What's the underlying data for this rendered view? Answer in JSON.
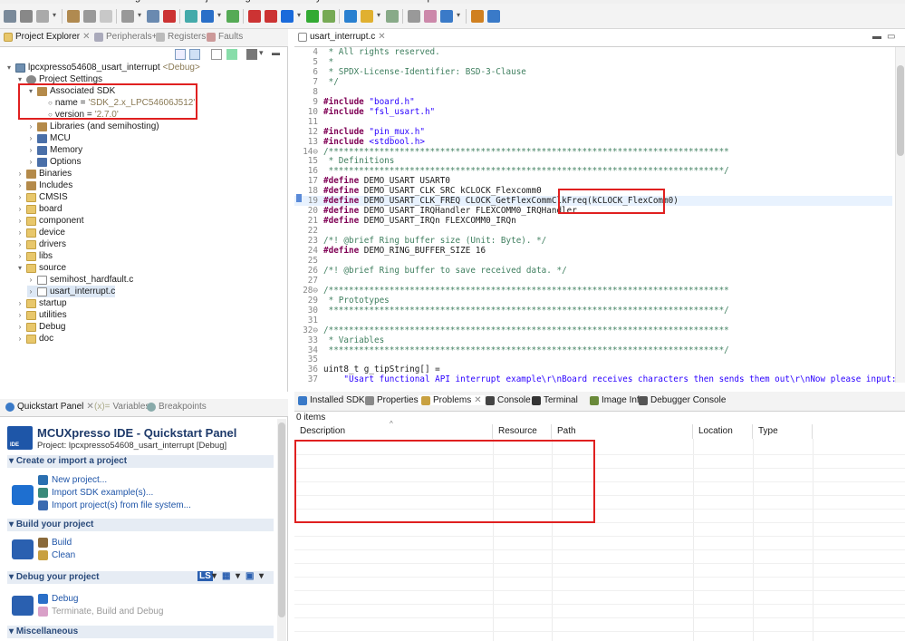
{
  "menubar": {
    "items": [
      "File",
      "Edit",
      "Source",
      "Refactor",
      "Navigate",
      "Search",
      "Project",
      "ConfigTools",
      "Run",
      "Analysis",
      "FreeRTOS",
      "Window",
      "Help"
    ]
  },
  "project_explorer": {
    "tabs": [
      {
        "label": "Project Explorer",
        "active": true,
        "icon": "folder-icon"
      },
      {
        "label": "Peripherals+",
        "active": false,
        "icon": "peripherals-icon"
      },
      {
        "label": "Registers",
        "active": false,
        "icon": "registers-icon"
      },
      {
        "label": "Faults",
        "active": false,
        "icon": "faults-icon"
      }
    ],
    "tree": [
      {
        "label": "lpcxpresso54608_usart_interrupt",
        "suffix": "<Debug>",
        "level": 0,
        "twisty": "expanded",
        "icon": "project-icon"
      },
      {
        "label": "Project Settings",
        "level": 1,
        "twisty": "expanded",
        "icon": "settings-icon"
      },
      {
        "label": "Associated SDK",
        "level": 2,
        "twisty": "expanded",
        "icon": "sdk-icon"
      },
      {
        "label": "name = ",
        "value": "'SDK_2.x_LPC54606J512'",
        "level": 3,
        "twisty": "none",
        "icon": "bullet-icon"
      },
      {
        "label": "version = ",
        "value": "'2.7.0'",
        "level": 3,
        "twisty": "none",
        "icon": "bullet-icon"
      },
      {
        "label": "Libraries (and semihosting)",
        "level": 2,
        "twisty": "collapsed",
        "icon": "library-icon"
      },
      {
        "label": "MCU",
        "level": 2,
        "twisty": "collapsed",
        "icon": "mcu-icon"
      },
      {
        "label": "Memory",
        "level": 2,
        "twisty": "collapsed",
        "icon": "memory-icon"
      },
      {
        "label": "Options",
        "level": 2,
        "twisty": "collapsed",
        "icon": "options-icon"
      },
      {
        "label": "Binaries",
        "level": 1,
        "twisty": "collapsed",
        "icon": "binaries-icon"
      },
      {
        "label": "Includes",
        "level": 1,
        "twisty": "collapsed",
        "icon": "includes-icon"
      },
      {
        "label": "CMSIS",
        "level": 1,
        "twisty": "collapsed",
        "icon": "folder-icon"
      },
      {
        "label": "board",
        "level": 1,
        "twisty": "collapsed",
        "icon": "folder-icon"
      },
      {
        "label": "component",
        "level": 1,
        "twisty": "collapsed",
        "icon": "folder-icon"
      },
      {
        "label": "device",
        "level": 1,
        "twisty": "collapsed",
        "icon": "folder-icon"
      },
      {
        "label": "drivers",
        "level": 1,
        "twisty": "collapsed",
        "icon": "folder-icon"
      },
      {
        "label": "libs",
        "level": 1,
        "twisty": "collapsed",
        "icon": "folder-icon"
      },
      {
        "label": "source",
        "level": 1,
        "twisty": "expanded",
        "icon": "folder-icon"
      },
      {
        "label": "semihost_hardfault.c",
        "level": 2,
        "twisty": "collapsed",
        "icon": "c-file-icon"
      },
      {
        "label": "usart_interrupt.c",
        "level": 2,
        "twisty": "collapsed",
        "icon": "c-file-icon",
        "selected": true
      },
      {
        "label": "startup",
        "level": 1,
        "twisty": "collapsed",
        "icon": "folder-icon"
      },
      {
        "label": "utilities",
        "level": 1,
        "twisty": "collapsed",
        "icon": "folder-icon"
      },
      {
        "label": "Debug",
        "level": 1,
        "twisty": "collapsed",
        "icon": "folder-icon"
      },
      {
        "label": "doc",
        "level": 1,
        "twisty": "collapsed",
        "icon": "folder-icon"
      }
    ]
  },
  "editor": {
    "tab_label": "usart_interrupt.c",
    "lines": [
      {
        "n": "4",
        "segs": [
          {
            "t": " * All rights reserved.",
            "c": "cmt"
          }
        ]
      },
      {
        "n": "5",
        "segs": [
          {
            "t": " *",
            "c": "cmt"
          }
        ]
      },
      {
        "n": "6",
        "segs": [
          {
            "t": " * SPDX-License-Identifier: BSD-3-Clause",
            "c": "cmt"
          }
        ]
      },
      {
        "n": "7",
        "segs": [
          {
            "t": " */",
            "c": "cmt"
          }
        ]
      },
      {
        "n": "8",
        "segs": []
      },
      {
        "n": "9",
        "segs": [
          {
            "t": "#include ",
            "c": "kw"
          },
          {
            "t": "\"board.h\"",
            "c": "str"
          }
        ]
      },
      {
        "n": "10",
        "segs": [
          {
            "t": "#include ",
            "c": "kw"
          },
          {
            "t": "\"fsl_usart.h\"",
            "c": "str"
          }
        ]
      },
      {
        "n": "11",
        "segs": []
      },
      {
        "n": "12",
        "segs": [
          {
            "t": "#include ",
            "c": "kw"
          },
          {
            "t": "\"pin_mux.h\"",
            "c": "str"
          }
        ]
      },
      {
        "n": "13",
        "segs": [
          {
            "t": "#include ",
            "c": "kw"
          },
          {
            "t": "<stdbool.h>",
            "c": "str"
          }
        ]
      },
      {
        "n": "14⊖",
        "segs": [
          {
            "t": "/*******************************************************************************",
            "c": "cmt"
          }
        ]
      },
      {
        "n": "15",
        "segs": [
          {
            "t": " * Definitions",
            "c": "cmt"
          }
        ]
      },
      {
        "n": "16",
        "segs": [
          {
            "t": " ******************************************************************************/",
            "c": "cmt"
          }
        ]
      },
      {
        "n": "17",
        "segs": [
          {
            "t": "#define ",
            "c": "kw"
          },
          {
            "t": "DEMO_USART USART0",
            "c": ""
          }
        ]
      },
      {
        "n": "18",
        "segs": [
          {
            "t": "#define ",
            "c": "kw"
          },
          {
            "t": "DEMO_USART_CLK_SRC kCLOCK_Flexcomm0",
            "c": ""
          }
        ]
      },
      {
        "n": "19",
        "segs": [
          {
            "t": "#define ",
            "c": "kw"
          },
          {
            "t": "DEMO_USART_CLK_FREQ CLOCK_GetFlexCommClkFreq(kCLOCK_FlexComm0)",
            "c": ""
          }
        ]
      },
      {
        "n": "20",
        "segs": [
          {
            "t": "#define ",
            "c": "kw"
          },
          {
            "t": "DEMO_USART_IRQHandler FLEXCOMM0_IRQHandler",
            "c": ""
          }
        ]
      },
      {
        "n": "21",
        "segs": [
          {
            "t": "#define ",
            "c": "kw"
          },
          {
            "t": "DEMO_USART_IRQn FLEXCOMM0_IRQn",
            "c": ""
          }
        ]
      },
      {
        "n": "22",
        "segs": []
      },
      {
        "n": "23",
        "segs": [
          {
            "t": "/*! @brief Ring buffer size (Unit: Byte). */",
            "c": "cmt"
          }
        ]
      },
      {
        "n": "24",
        "segs": [
          {
            "t": "#define ",
            "c": "kw"
          },
          {
            "t": "DEMO_RING_BUFFER_SIZE 16",
            "c": ""
          }
        ]
      },
      {
        "n": "25",
        "segs": []
      },
      {
        "n": "26",
        "segs": [
          {
            "t": "/*! @brief Ring buffer to save received data. */",
            "c": "cmt"
          }
        ]
      },
      {
        "n": "27",
        "segs": []
      },
      {
        "n": "28⊖",
        "segs": [
          {
            "t": "/*******************************************************************************",
            "c": "cmt"
          }
        ]
      },
      {
        "n": "29",
        "segs": [
          {
            "t": " * Prototypes",
            "c": "cmt"
          }
        ]
      },
      {
        "n": "30",
        "segs": [
          {
            "t": " ******************************************************************************/",
            "c": "cmt"
          }
        ]
      },
      {
        "n": "31",
        "segs": []
      },
      {
        "n": "32⊖",
        "segs": [
          {
            "t": "/*******************************************************************************",
            "c": "cmt"
          }
        ]
      },
      {
        "n": "33",
        "segs": [
          {
            "t": " * Variables",
            "c": "cmt"
          }
        ]
      },
      {
        "n": "34",
        "segs": [
          {
            "t": " ******************************************************************************/",
            "c": "cmt"
          }
        ]
      },
      {
        "n": "35",
        "segs": []
      },
      {
        "n": "36",
        "segs": [
          {
            "t": "uint8_t g_tipString[] =",
            "c": ""
          }
        ]
      },
      {
        "n": "37",
        "segs": [
          {
            "t": "    \"Usart functional API interrupt example\\r\\nBoard receives characters then sends them out\\r\\nNow please input:\\r\\n\";",
            "c": "str"
          }
        ]
      }
    ]
  },
  "quickstart": {
    "tabs": [
      {
        "label": "Quickstart Panel",
        "active": true
      },
      {
        "label": "Variables",
        "active": false
      },
      {
        "label": "Breakpoints",
        "active": false
      }
    ],
    "title": "MCUXpresso IDE - Quickstart Panel",
    "project_line": "Project: lpcxpresso54608_usart_interrupt [Debug]",
    "sections": [
      {
        "title": "Create or import a project",
        "links": [
          {
            "label": "New project...",
            "icon": "new-project-icon",
            "enabled": true
          },
          {
            "label": "Import SDK example(s)...",
            "icon": "import-sdk-icon",
            "enabled": true
          },
          {
            "label": "Import project(s) from file system...",
            "icon": "import-fs-icon",
            "enabled": true
          }
        ]
      },
      {
        "title": "Build your project",
        "links": [
          {
            "label": "Build",
            "icon": "hammer-icon",
            "enabled": true
          },
          {
            "label": "Clean",
            "icon": "brush-icon",
            "enabled": true
          }
        ]
      },
      {
        "title": "Debug your project",
        "links": [
          {
            "label": "Debug",
            "icon": "bug-icon",
            "enabled": true
          },
          {
            "label": "Terminate, Build and Debug",
            "icon": "terminate-icon",
            "enabled": false
          }
        ]
      },
      {
        "title": "Miscellaneous",
        "links": []
      }
    ],
    "debug_toolbar": [
      "LS",
      "▾",
      "▦",
      "▾",
      "▣",
      "▾"
    ]
  },
  "bottom": {
    "tabs": [
      {
        "label": "Installed SDKs",
        "active": false
      },
      {
        "label": "Properties",
        "active": false
      },
      {
        "label": "Problems",
        "active": true
      },
      {
        "label": "Console",
        "active": false
      },
      {
        "label": "Terminal",
        "active": false
      },
      {
        "label": "Image Info",
        "active": false
      },
      {
        "label": "Debugger Console",
        "active": false
      }
    ],
    "status": "0 items",
    "columns": [
      "Description",
      "Resource",
      "Path",
      "Location",
      "Type"
    ]
  },
  "colors": {
    "annotation": "#e02020",
    "link": "#1f55a8",
    "selection": "#dde8f5"
  }
}
